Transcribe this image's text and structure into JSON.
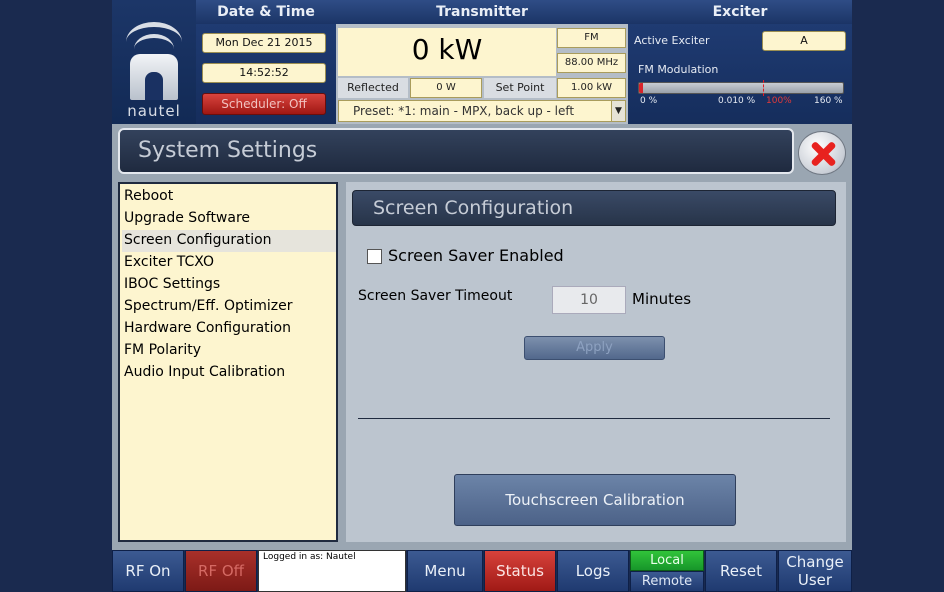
{
  "header": {
    "logo_text": "nautel",
    "datetime": {
      "title": "Date & Time",
      "date": "Mon Dec 21 2015",
      "time": "14:52:52",
      "scheduler": "Scheduler: Off"
    },
    "transmitter": {
      "title": "Transmitter",
      "power": "0 kW",
      "mode": "FM",
      "frequency": "88.00 MHz",
      "reflected_label": "Reflected",
      "reflected_value": "0 W",
      "setpoint_label": "Set Point",
      "setpoint_value": "1.00 kW",
      "preset": "Preset: *1: main - MPX, back up - left"
    },
    "exciter": {
      "title": "Exciter",
      "active_label": "Active Exciter",
      "active_value": "A",
      "mod_label": "FM Modulation",
      "mod_level_percent": 0.01,
      "scale_min": "0 %",
      "scale_value": "0.010 %",
      "scale_mark": "100%",
      "scale_max": "160 %"
    }
  },
  "window": {
    "title": "System Settings",
    "menu": [
      "Reboot",
      "Upgrade Software",
      "Screen Configuration",
      "Exciter TCXO",
      "IBOC Settings",
      "Spectrum/Eff. Optimizer",
      "Hardware Configuration",
      "FM Polarity",
      "Audio Input Calibration"
    ],
    "selected_index": 2
  },
  "screen_config": {
    "heading": "Screen Configuration",
    "screensaver_label": "Screen Saver Enabled",
    "screensaver_checked": false,
    "timeout_label": "Screen Saver Timeout",
    "timeout_value": "10",
    "timeout_unit": "Minutes",
    "apply_label": "Apply",
    "calibration_label": "Touchscreen Calibration"
  },
  "bottom": {
    "rf_on": "RF On",
    "rf_off": "RF Off",
    "logged_in": "Logged in as: Nautel",
    "menu": "Menu",
    "status": "Status",
    "logs": "Logs",
    "local": "Local",
    "remote": "Remote",
    "reset": "Reset",
    "change_user_1": "Change",
    "change_user_2": "User"
  },
  "colors": {
    "accent_yellow": "#fdf5cf",
    "alarm_red": "#d7423b",
    "local_green": "#31c43a",
    "panel_blue": "#1f3b72"
  },
  "icons": {
    "close": "close-x-icon",
    "dropdown": "chevron-down-icon",
    "logo": "nautel-logo-icon"
  }
}
